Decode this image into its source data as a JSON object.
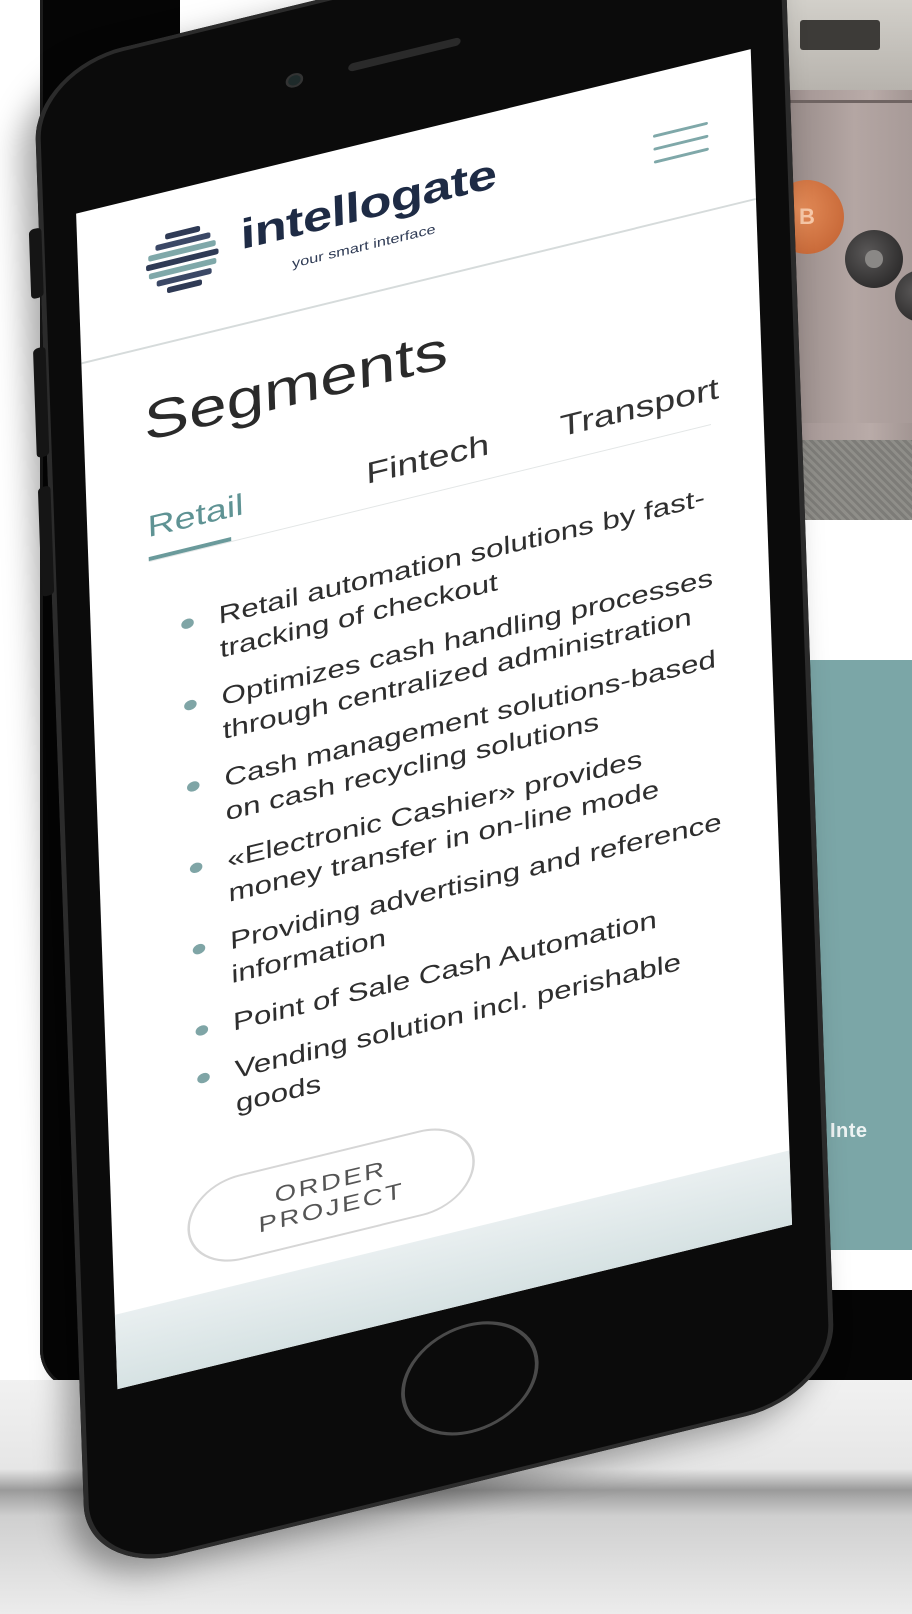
{
  "laptop_site": {
    "teal_banner_label": "Inte"
  },
  "atm_photo": {
    "bitcoin_symbol": "B"
  },
  "phone_site": {
    "brand": {
      "name": "intellogate",
      "tagline": "your smart interface",
      "accent_color": "#7fa8a9",
      "text_color": "#1e2b45"
    },
    "menu_icon": "hamburger-icon",
    "page_title": "Segments",
    "tabs": [
      {
        "label": "Retail",
        "active": true
      },
      {
        "label": "Fintech",
        "active": false
      },
      {
        "label": "Transport",
        "active": false
      }
    ],
    "features": [
      "Retail automation solutions by fast-tracking of checkout",
      "Optimizes cash handling processes through centralized administration",
      "Cash management solutions-based on cash recycling solutions",
      "«Electronic Cashier» provides money transfer in on-line mode",
      "Providing advertising and reference information",
      "Point of Sale Cash Automation",
      "Vending solution incl. perishable goods"
    ],
    "cta_label": "ORDER PROJECT"
  }
}
